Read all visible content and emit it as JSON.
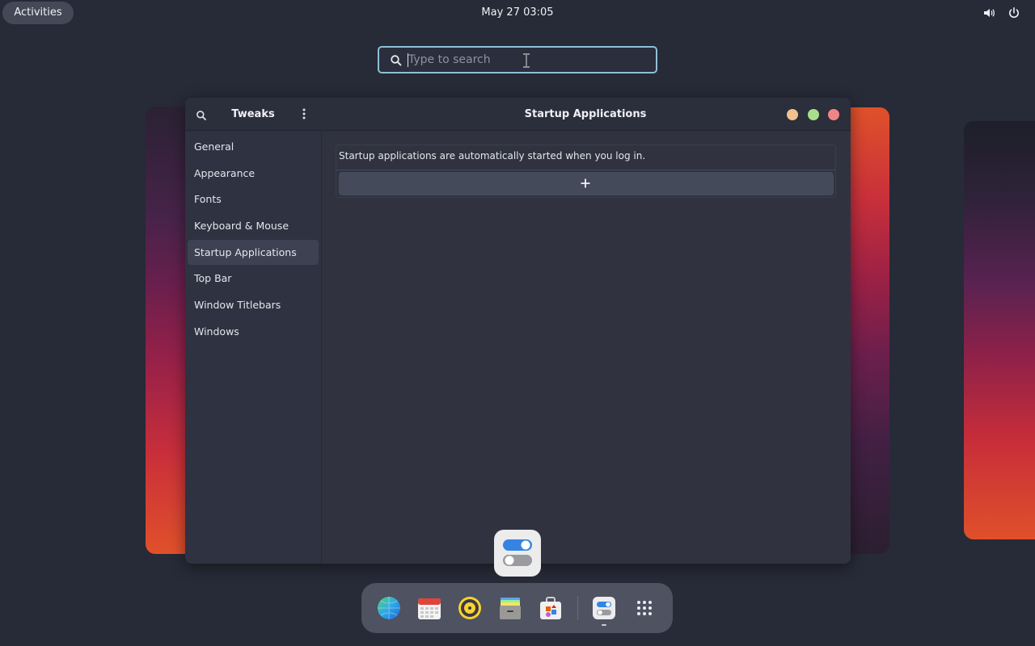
{
  "topbar": {
    "activities_label": "Activities",
    "clock": "May 27  03:05",
    "volume_icon": "volume-icon",
    "power_icon": "power-icon"
  },
  "search": {
    "placeholder": "Type to search",
    "value": ""
  },
  "window": {
    "app_title": "Tweaks",
    "page_title": "Startup Applications",
    "sidebar": {
      "items": [
        {
          "label": "General"
        },
        {
          "label": "Appearance"
        },
        {
          "label": "Fonts"
        },
        {
          "label": "Keyboard & Mouse"
        },
        {
          "label": "Startup Applications",
          "active": true
        },
        {
          "label": "Top Bar"
        },
        {
          "label": "Window Titlebars"
        },
        {
          "label": "Windows"
        }
      ]
    },
    "content": {
      "info_text": "Startup applications are automatically started when you log in.",
      "add_button_icon": "plus-icon"
    },
    "controls": {
      "minimize_color": "#f1c28b",
      "maximize_color": "#a8df8c",
      "close_color": "#f08585"
    }
  },
  "dock": {
    "items": [
      {
        "icon": "browser-icon"
      },
      {
        "icon": "calendar-icon"
      },
      {
        "icon": "music-player-icon"
      },
      {
        "icon": "file-manager-icon"
      },
      {
        "icon": "software-store-icon"
      },
      {
        "icon": "tweaks-icon",
        "running": true
      },
      {
        "icon": "app-grid-icon"
      }
    ]
  },
  "colors": {
    "accent": "#8fbfd6",
    "background": "#272a37",
    "window": "#303444"
  }
}
